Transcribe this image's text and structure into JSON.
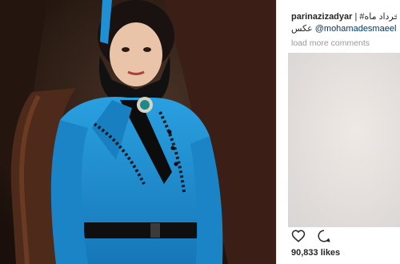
{
  "post": {
    "username": "parinazizadyar",
    "caption_text": "از ۳۹ خرداد ماه# |",
    "mention": "@mohamadesmaeeli",
    "caption_word": "عکس",
    "load_more": "load more comments",
    "likes": "90,833 likes"
  },
  "icons": {
    "like": "heart-icon",
    "comment": "comment-icon"
  },
  "colors": {
    "coat": "#1e8fd0",
    "background": "#3a2418",
    "mention": "#003569",
    "meta": "#999999"
  }
}
